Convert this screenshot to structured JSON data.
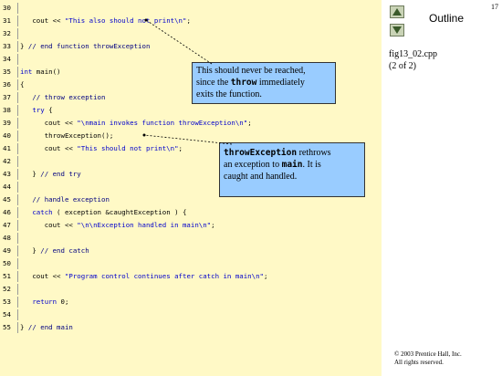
{
  "page_number": "17",
  "outline": {
    "title": "Outline",
    "up_icon": "triangle-up-icon",
    "down_icon": "triangle-down-icon",
    "figure_file": "fig13_02.cpp",
    "figure_page": "(2 of 2)"
  },
  "code_lines": [
    {
      "num": "30",
      "parts": []
    },
    {
      "num": "31",
      "parts": [
        {
          "t": "   cout << ",
          "c": ""
        },
        {
          "t": "\"This also should not print\\n\"",
          "c": "str"
        },
        {
          "t": ";",
          "c": ""
        }
      ]
    },
    {
      "num": "32",
      "parts": []
    },
    {
      "num": "33",
      "parts": [
        {
          "t": "} ",
          "c": ""
        },
        {
          "t": "// end function throwException",
          "c": "cm"
        }
      ]
    },
    {
      "num": "34",
      "parts": []
    },
    {
      "num": "35",
      "parts": [
        {
          "t": "int",
          "c": "kw"
        },
        {
          "t": " main()",
          "c": ""
        }
      ]
    },
    {
      "num": "36",
      "parts": [
        {
          "t": "{",
          "c": ""
        }
      ]
    },
    {
      "num": "37",
      "parts": [
        {
          "t": "   ",
          "c": ""
        },
        {
          "t": "// throw exception",
          "c": "cm"
        }
      ]
    },
    {
      "num": "38",
      "parts": [
        {
          "t": "   ",
          "c": ""
        },
        {
          "t": "try",
          "c": "kw"
        },
        {
          "t": " {",
          "c": ""
        }
      ]
    },
    {
      "num": "39",
      "parts": [
        {
          "t": "      cout << ",
          "c": ""
        },
        {
          "t": "\"\\nmain invokes function throwException\\n\"",
          "c": "str"
        },
        {
          "t": ";",
          "c": ""
        }
      ]
    },
    {
      "num": "40",
      "parts": [
        {
          "t": "      throwException();",
          "c": ""
        }
      ]
    },
    {
      "num": "41",
      "parts": [
        {
          "t": "      cout << ",
          "c": ""
        },
        {
          "t": "\"This should not print\\n\"",
          "c": "str"
        },
        {
          "t": ";",
          "c": ""
        }
      ]
    },
    {
      "num": "42",
      "parts": []
    },
    {
      "num": "43",
      "parts": [
        {
          "t": "   } ",
          "c": ""
        },
        {
          "t": "// end try",
          "c": "cm"
        }
      ]
    },
    {
      "num": "44",
      "parts": []
    },
    {
      "num": "45",
      "parts": [
        {
          "t": "   ",
          "c": ""
        },
        {
          "t": "// handle exception",
          "c": "cm"
        }
      ]
    },
    {
      "num": "46",
      "parts": [
        {
          "t": "   ",
          "c": ""
        },
        {
          "t": "catch",
          "c": "kw"
        },
        {
          "t": " ( exception &caughtException ) {",
          "c": ""
        }
      ]
    },
    {
      "num": "47",
      "parts": [
        {
          "t": "      cout << ",
          "c": ""
        },
        {
          "t": "\"\\n\\nException handled in main\\n\"",
          "c": "str"
        },
        {
          "t": ";",
          "c": ""
        }
      ]
    },
    {
      "num": "48",
      "parts": []
    },
    {
      "num": "49",
      "parts": [
        {
          "t": "   } ",
          "c": ""
        },
        {
          "t": "// end catch",
          "c": "cm"
        }
      ]
    },
    {
      "num": "50",
      "parts": []
    },
    {
      "num": "51",
      "parts": [
        {
          "t": "   cout << ",
          "c": ""
        },
        {
          "t": "\"Program control continues after catch in main\\n\"",
          "c": "str"
        },
        {
          "t": ";",
          "c": ""
        }
      ]
    },
    {
      "num": "52",
      "parts": []
    },
    {
      "num": "53",
      "parts": [
        {
          "t": "   ",
          "c": ""
        },
        {
          "t": "return",
          "c": "kw"
        },
        {
          "t": " 0;",
          "c": ""
        }
      ]
    },
    {
      "num": "54",
      "parts": []
    },
    {
      "num": "55",
      "parts": [
        {
          "t": "} ",
          "c": ""
        },
        {
          "t": "// end main",
          "c": "cm"
        }
      ]
    }
  ],
  "callout1": {
    "text_a": "This should never be reached,",
    "text_b": "since the ",
    "code": "throw",
    "text_c": " immediately",
    "text_d": "exits the function."
  },
  "callout2": {
    "code1": "throwException",
    "text_a": " rethrows",
    "text_b": "an exception to ",
    "code2": "main",
    "text_c": ". It is",
    "text_d": "caught and handled."
  },
  "copyright": {
    "line1": "© 2003 Prentice Hall, Inc.",
    "line2": "All rights reserved."
  }
}
